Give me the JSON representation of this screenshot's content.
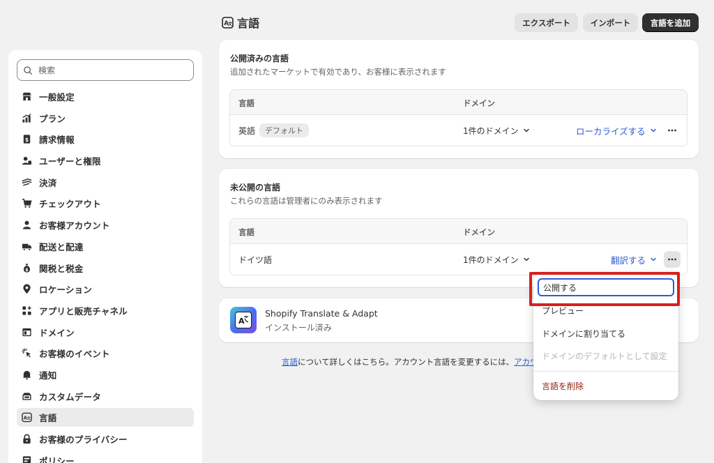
{
  "header": {
    "title": "言語",
    "export_label": "エクスポート",
    "import_label": "インポート",
    "add_label": "言語を追加"
  },
  "sidebar": {
    "search_placeholder": "検索",
    "items": [
      {
        "label": "一般設定",
        "icon": "store-icon"
      },
      {
        "label": "プラン",
        "icon": "plan-chart-icon"
      },
      {
        "label": "請求情報",
        "icon": "billing-icon"
      },
      {
        "label": "ユーザーと権限",
        "icon": "users-icon"
      },
      {
        "label": "決済",
        "icon": "payments-icon"
      },
      {
        "label": "チェックアウト",
        "icon": "cart-icon"
      },
      {
        "label": "お客様アカウント",
        "icon": "person-icon"
      },
      {
        "label": "配送と配達",
        "icon": "truck-icon"
      },
      {
        "label": "関税と税金",
        "icon": "money-bag-icon"
      },
      {
        "label": "ロケーション",
        "icon": "location-pin-icon"
      },
      {
        "label": "アプリと販売チャネル",
        "icon": "apps-icon"
      },
      {
        "label": "ドメイン",
        "icon": "domain-icon"
      },
      {
        "label": "お客様のイベント",
        "icon": "cursor-click-icon"
      },
      {
        "label": "通知",
        "icon": "bell-icon"
      },
      {
        "label": "カスタムデータ",
        "icon": "custom-data-icon"
      },
      {
        "label": "言語",
        "icon": "language-icon"
      },
      {
        "label": "お客様のプライバシー",
        "icon": "lock-icon"
      },
      {
        "label": "ポリシー",
        "icon": "policy-icon"
      }
    ]
  },
  "published": {
    "title": "公開済みの言語",
    "subtitle": "追加されたマーケットで有効であり、お客様に表示されます",
    "col_language": "言語",
    "col_domain": "ドメイン",
    "row": {
      "language": "英語",
      "badge": "デフォルト",
      "domain": "1件のドメイン",
      "action": "ローカライズする"
    }
  },
  "unpublished": {
    "title": "未公開の言語",
    "subtitle": "これらの言語は管理者にのみ表示されます",
    "col_language": "言語",
    "col_domain": "ドメイン",
    "row": {
      "language": "ドイツ語",
      "domain": "1件のドメイン",
      "action": "翻訳する"
    }
  },
  "app": {
    "name": "Shopify Translate & Adapt",
    "status": "インストール済み"
  },
  "footer": {
    "link1": "言語",
    "text": "について詳しくはこちら。アカウント言語を変更するには、",
    "link2": "アカウ"
  },
  "menu": {
    "publish": "公開する",
    "preview": "プレビュー",
    "assign_domain": "ドメインに割り当てる",
    "set_default": "ドメインのデフォルトとして設定",
    "delete": "言語を削除"
  },
  "colors": {
    "accent_link": "#2a5bd7",
    "primary_button": "#303030",
    "highlight": "#d81f1f",
    "danger": "#8e1f0b"
  }
}
